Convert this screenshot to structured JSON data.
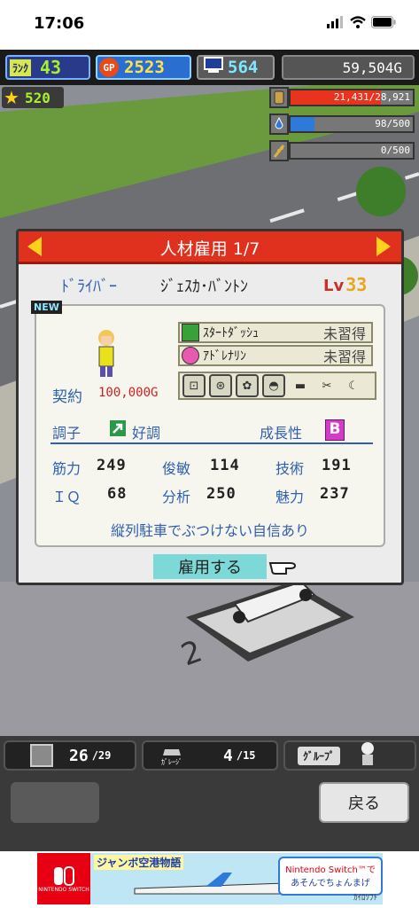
{
  "status_bar": {
    "time": "17:06"
  },
  "hud": {
    "rank_label": "ﾗﾝｸ",
    "rank_value": "43",
    "gp_label": "GP",
    "gp_value": "2523",
    "pc_value": "564",
    "money": "59,504G",
    "star_value": "520"
  },
  "resources": [
    {
      "icon": "fuel-icon",
      "value": "21,431/28,921",
      "fill": 0.741,
      "color": "#e8341c"
    },
    {
      "icon": "oil-icon",
      "value": "98/500",
      "fill": 0.196,
      "color": "#2f7ad8"
    },
    {
      "icon": "wheat-icon",
      "value": "0/500",
      "fill": 0.0,
      "color": "#6f8c2a"
    }
  ],
  "dialog": {
    "title": "人材雇用 1/7",
    "job": "ﾄﾞﾗｲﾊﾞｰ",
    "name": "ｼﾞｪｽｶ･ﾊﾞﾝﾄﾝ",
    "level_label": "Lv",
    "level": "33",
    "new_badge": "NEW",
    "contract_label": "契約",
    "contract_value": "100,000G",
    "skills": [
      {
        "name": "ｽﾀｰﾄﾀﾞｯｼｭ",
        "status": "未習得"
      },
      {
        "name": "ｱﾄﾞﾚﾅﾘﾝ",
        "status": "未習得"
      }
    ],
    "condition_label": "調子",
    "condition_value": "好調",
    "growth_label": "成長性",
    "growth_value": "B",
    "stats": [
      {
        "label": "筋力",
        "value": "249"
      },
      {
        "label": "俊敏",
        "value": "114"
      },
      {
        "label": "技術",
        "value": "191"
      },
      {
        "label": "ＩＱ",
        "value": "68"
      },
      {
        "label": "分析",
        "value": "250"
      },
      {
        "label": "魅力",
        "value": "237"
      }
    ],
    "description": "縦列駐車でぶつけない自信あり",
    "hire_button": "雇用する"
  },
  "bottom": {
    "tab1_value": "26",
    "tab1_max": "/29",
    "tab2_value": "4",
    "tab2_max": "/15",
    "tab2_sub": "ｶﾞﾚｰｼﾞ",
    "group_label": "ｸﾞﾙｰﾌﾟ",
    "back_button": "戻る"
  },
  "ad": {
    "brand": "NINTENDO SWITCH",
    "game_title": "ジャンボ空港物語",
    "text_line1": "Nintendo Switch™で",
    "text_line2": "あそんでちょんまげ",
    "publisher": "ｶｲﾛｿﾌﾄ"
  }
}
